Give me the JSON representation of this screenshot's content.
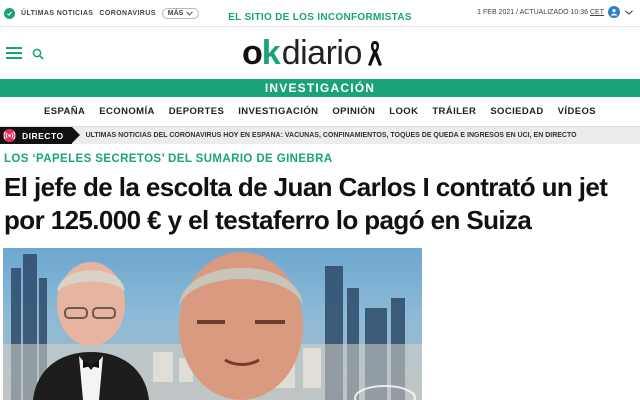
{
  "topbar": {
    "latest_news": "ÚLTIMAS NOTICIAS",
    "coronavirus": "CORONAVIRUS",
    "more": "MÁS",
    "tagline": "EL SITIO DE LOS INCONFORMISTAS",
    "date": "1 FEB 2021 / ACTUALIZADO 10:36",
    "tz": "CET"
  },
  "logo": {
    "ok_o": "o",
    "ok_k": "k",
    "diario": "diario"
  },
  "section_band": "INVESTIGACIÓN",
  "nav": [
    "ESPAÑA",
    "ECONOMÍA",
    "DEPORTES",
    "INVESTIGACIÓN",
    "OPINIÓN",
    "LOOK",
    "TRÁILER",
    "SOCIEDAD",
    "VÍDEOS"
  ],
  "live": {
    "label": "DIRECTO",
    "text": "ÚLTIMAS NOTICIAS DEL CORONAVIRUS HOY EN ESPAÑA: VACUNAS, CONFINAMIENTOS, TOQUES DE QUEDA E INGRESOS EN UCI, EN DIRECTO"
  },
  "article": {
    "kicker": "LOS ‘PAPELES SECRETOS’ DEL SUMARIO DE GINEBRA",
    "headline": "El jefe de la escolta de Juan Carlos I contrató un jet por 125.000 € y el testaferro lo pagó en Suiza"
  },
  "colors": {
    "brand": "#1aa37a",
    "live": "#e0325c",
    "user": "#2f7fc4"
  },
  "icons": [
    "check-circle-icon",
    "chevron-down-icon",
    "user-icon",
    "menu-icon",
    "search-icon",
    "mourning-ribbon-icon",
    "live-broadcast-icon"
  ]
}
